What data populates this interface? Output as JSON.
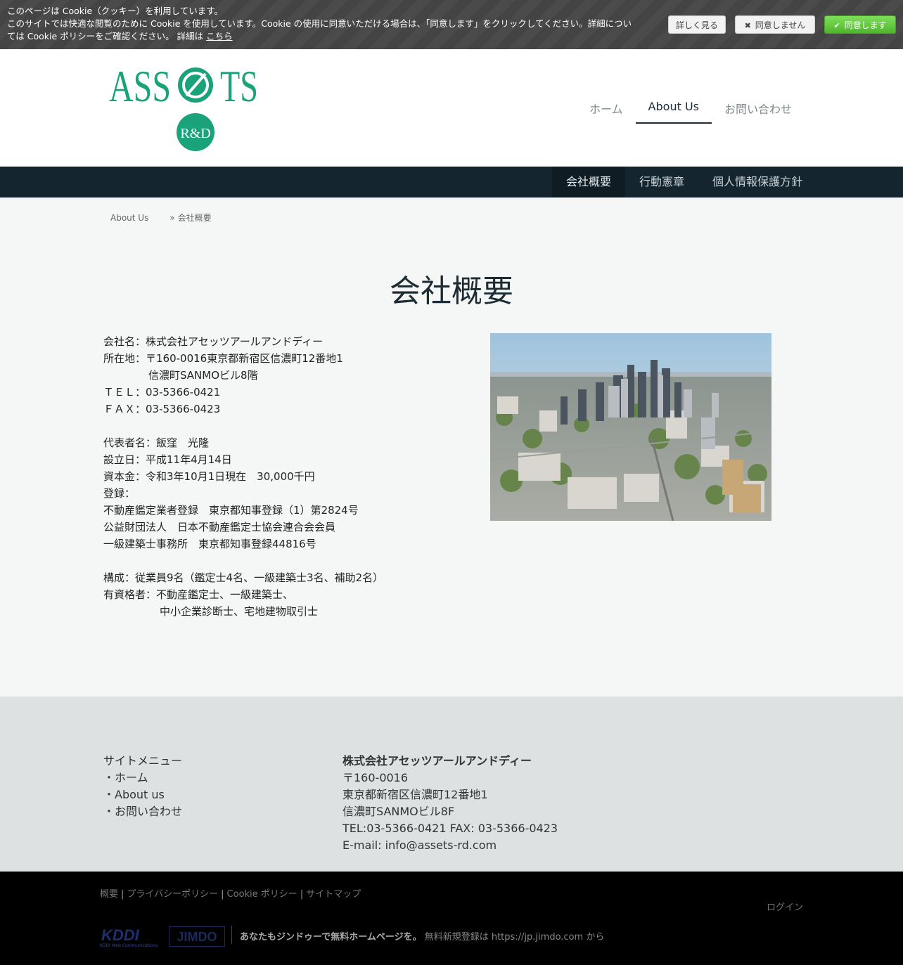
{
  "cookie": {
    "line1": "このページは Cookie（クッキー）を利用しています。",
    "line2": "このサイトでは快適な閲覧のために Cookie を使用しています。Cookie の使用に同意いただける場合は、「同意します」をクリックしてください。詳細についてはCookie ポリシーをご確認ください。 詳細は",
    "line2a": "このサイトでは快適な閲覧のために Cookie を使用しています。Cookie の使用に同意いただける場合は、「同意します」をクリックしてください。詳細につい",
    "line2b": "ては Cookie ポリシーをご確認ください。 詳細は ",
    "link": "こちら",
    "more_label": "詳しく見る",
    "decline_label": "同意しません",
    "accept_label": "同意します"
  },
  "logo": {
    "text_left": "ASS",
    "text_right": "TS",
    "badge": "R&D",
    "brand_color": "#1aa37a"
  },
  "mainnav": {
    "items": [
      {
        "label": "ホーム"
      },
      {
        "label": "About Us"
      },
      {
        "label": "お問い合わせ"
      }
    ]
  },
  "subnav": {
    "items": [
      {
        "label": "会社概要"
      },
      {
        "label": "行動憲章"
      },
      {
        "label": "個人情報保護方針"
      }
    ]
  },
  "breadcrumb": {
    "parent": "About Us",
    "separator": "»",
    "current": "会社概要"
  },
  "page": {
    "title": "会社概要"
  },
  "info": {
    "lines": [
      "会社名：株式会社アセッツアールアンドディー",
      "所在地：〒160-0016東京都新宿区信濃町12番地1",
      "信濃町SANMOビル8階",
      "ＴＥＬ：03-5366-0421",
      "ＦＡＸ：03-5366-0423",
      "代表者名：飯窪　光隆",
      "設立日：平成11年4月14日",
      "資本金：令和3年10月1日現在　30,000千円",
      "登録：",
      "不動産鑑定業者登録　東京都知事登録（1）第2824号",
      "公益財団法人　日本不動産鑑定士協会連合会会員",
      "一級建築士事務所　東京都知事登録44816号",
      "構成：従業員9名（鑑定士4名、一級建築士3名、補助2名）",
      "有資格者：不動産鑑定士、一級建築士、",
      "中小企業診断士、宅地建物取引士"
    ]
  },
  "footer": {
    "menu_title": "サイトメニュー",
    "menu": [
      "・ホーム",
      "・About us",
      "・お問い合わせ"
    ],
    "company": {
      "name": "株式会社アセッツアールアンドディー",
      "postal": "〒160-0016",
      "address1": "東京都新宿区信濃町12番地1",
      "address2": "信濃町SANMOビル8F",
      "tel_fax": "TEL:03-5366-0421 FAX: 03-5366-0423",
      "email": "E-mail: info@assets-rd.com"
    }
  },
  "bottom": {
    "links": [
      "概要",
      "プライバシーポリシー",
      "Cookie ポリシー",
      "サイトマップ"
    ],
    "separator": "|",
    "login": "ログイン",
    "kddi": "KDDI",
    "kddi_sub": "KDDI Web Communications",
    "jimdo": "JIMDO",
    "promo_bold": "あなたもジンドゥーで無料ホームページを。",
    "promo_rest": " 無料新規登録は https://jp.jimdo.com から"
  }
}
